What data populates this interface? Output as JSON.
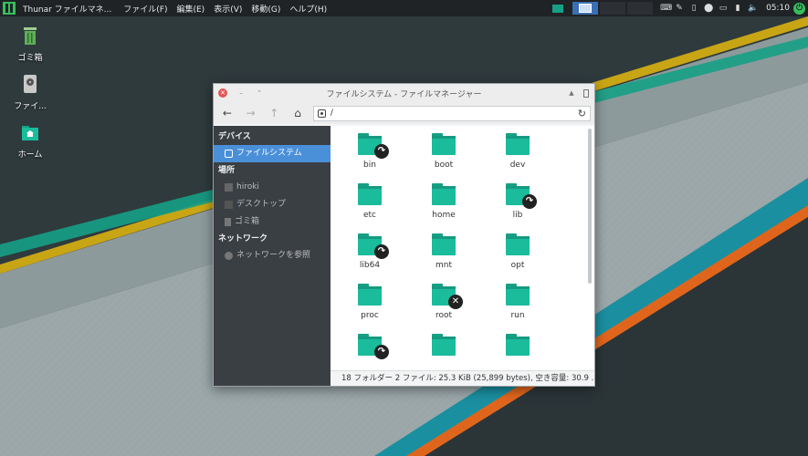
{
  "panel": {
    "task_title": "Thunar ファイルマネ...",
    "menus": [
      "ファイル(F)",
      "編集(E)",
      "表示(V)",
      "移動(G)",
      "ヘルプ(H)"
    ],
    "clock": "05:10"
  },
  "desktop": {
    "icons": [
      {
        "label": "ゴミ箱",
        "icon": "trash-icon"
      },
      {
        "label": "ファイ...",
        "icon": "drive-icon"
      },
      {
        "label": "ホーム",
        "icon": "home-folder-icon"
      }
    ]
  },
  "window": {
    "title": "ファイルシステム - ファイルマネージャー",
    "location": "/",
    "sidebar": {
      "devices_header": "デバイス",
      "filesystem": "ファイルシステム",
      "places_header": "場所",
      "home": "hiroki",
      "desktop": "デスクトップ",
      "trash": "ゴミ箱",
      "network_header": "ネットワーク",
      "browse_network": "ネットワークを参照"
    },
    "files": [
      {
        "name": "bin",
        "emblem": "symlink"
      },
      {
        "name": "boot",
        "emblem": ""
      },
      {
        "name": "dev",
        "emblem": ""
      },
      {
        "name": "etc",
        "emblem": ""
      },
      {
        "name": "home",
        "emblem": ""
      },
      {
        "name": "lib",
        "emblem": "symlink"
      },
      {
        "name": "lib64",
        "emblem": "symlink"
      },
      {
        "name": "mnt",
        "emblem": ""
      },
      {
        "name": "opt",
        "emblem": ""
      },
      {
        "name": "proc",
        "emblem": ""
      },
      {
        "name": "root",
        "emblem": "no-access"
      },
      {
        "name": "run",
        "emblem": ""
      },
      {
        "name": "",
        "emblem": "symlink"
      },
      {
        "name": "",
        "emblem": ""
      },
      {
        "name": "",
        "emblem": ""
      }
    ],
    "status": "18 フォルダー 2 ファイル: 25.3 KiB (25,899 bytes), 空き容量: 30.9 ..."
  },
  "colors": {
    "accent": "#4a90d9",
    "folder": "#1abc9c",
    "panel": "#1f2326",
    "sidebar": "#3a3f44"
  }
}
